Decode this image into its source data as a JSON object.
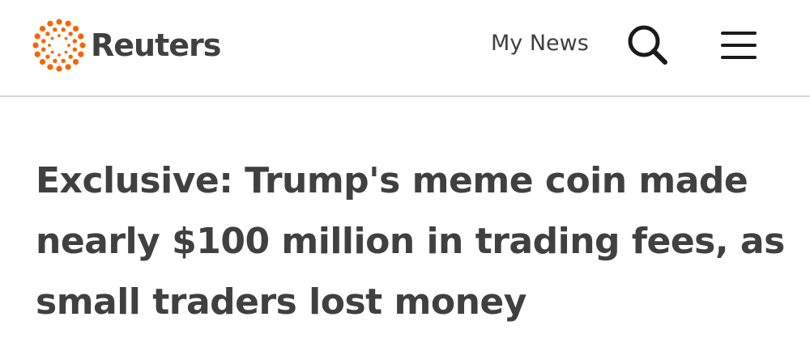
{
  "header": {
    "logo_text": "Reuters",
    "logo_icon": "reuters-dot-ring-icon",
    "my_news_label": "My News",
    "search_icon": "search-icon",
    "menu_icon": "hamburger-menu-icon",
    "brand_color": "#fa6400",
    "text_color": "#404040"
  },
  "article": {
    "headline": "Exclusive: Trump's meme coin made nearly $100 million in trading fees, as small traders lost money"
  }
}
